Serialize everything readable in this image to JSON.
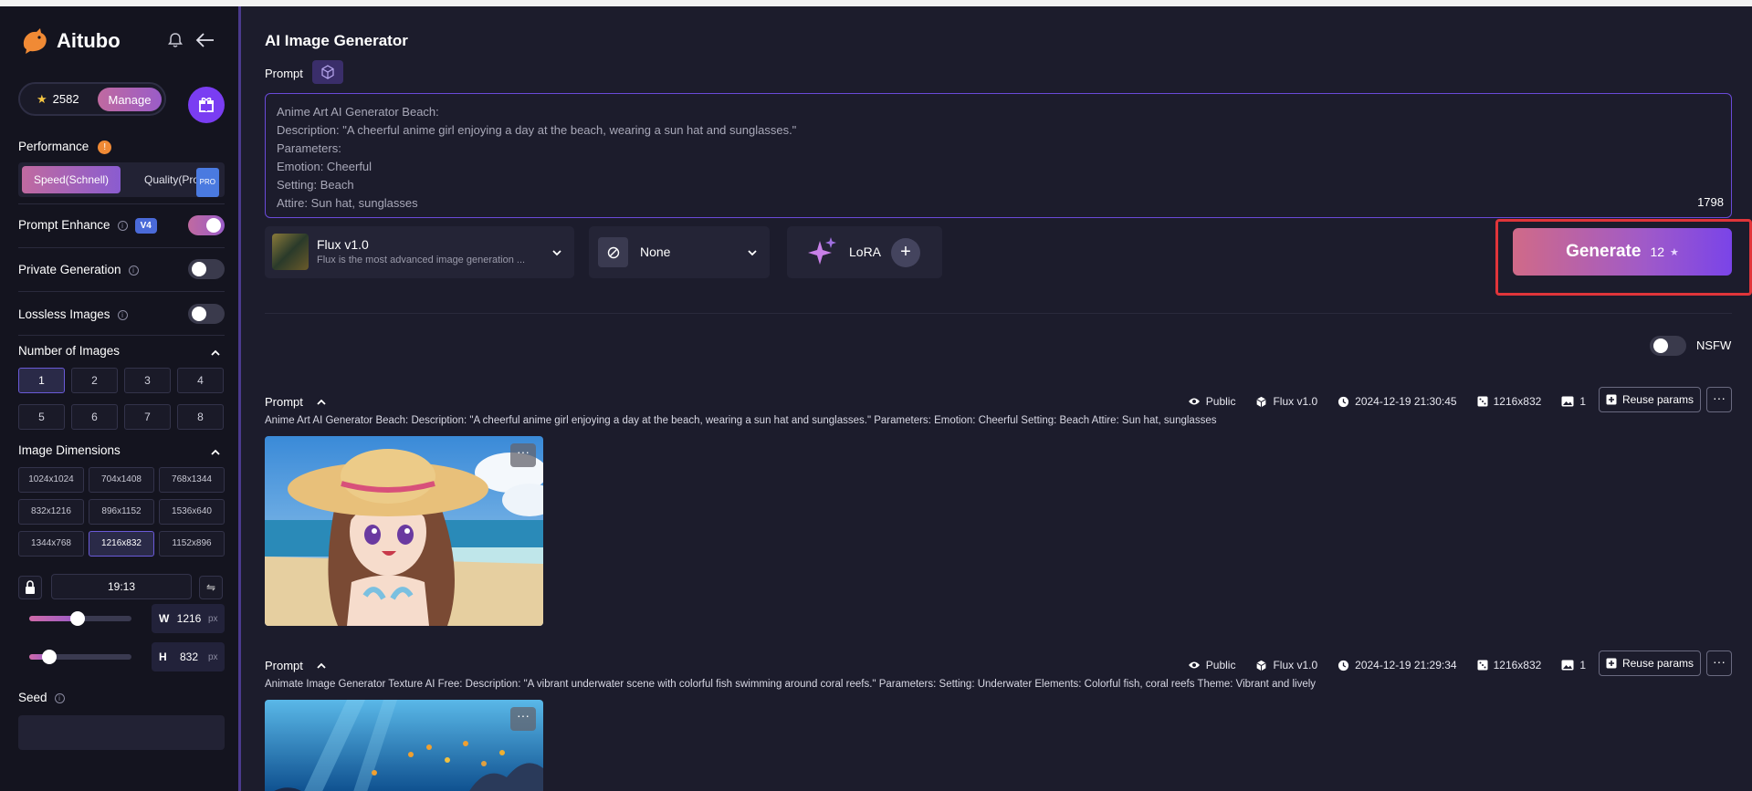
{
  "brand": {
    "name": "Aitubo"
  },
  "credits": {
    "count": "2582",
    "manage_label": "Manage"
  },
  "sidebar": {
    "performance": {
      "label": "Performance",
      "info": "!",
      "speed_label": "Speed(Schnell)",
      "quality_label": "Quality(Pro)",
      "pro_badge": "PRO"
    },
    "prompt_enhance": {
      "label": "Prompt Enhance",
      "badge": "V4",
      "on": true
    },
    "private_generation": {
      "label": "Private Generation",
      "on": false
    },
    "lossless_images": {
      "label": "Lossless Images",
      "on": false
    },
    "number_of_images": {
      "label": "Number of Images",
      "options": [
        "1",
        "2",
        "3",
        "4",
        "5",
        "6",
        "7",
        "8"
      ],
      "selected": "1"
    },
    "image_dimensions": {
      "label": "Image Dimensions",
      "options": [
        "1024x1024",
        "704x1408",
        "768x1344",
        "832x1216",
        "896x1152",
        "1536x640",
        "1344x768",
        "1216x832",
        "1152x896"
      ],
      "selected": "1216x832",
      "ratio": "19:13",
      "swap_icon": "⇋",
      "width_label": "W",
      "width_value": "1216",
      "height_label": "H",
      "height_value": "832",
      "unit": "px",
      "width_fraction": 0.47,
      "height_fraction": 0.2
    },
    "seed": {
      "label": "Seed",
      "value": ""
    }
  },
  "main": {
    "title": "AI Image Generator",
    "prompt_label": "Prompt",
    "prompt_lines": [
      "Anime Art AI Generator Beach:",
      "Description: \"A cheerful anime girl enjoying a day at the beach, wearing a sun hat and sunglasses.\"",
      "Parameters:",
      "Emotion: Cheerful",
      "Setting: Beach",
      "Attire: Sun hat, sunglasses"
    ],
    "char_count": "1798",
    "model": {
      "name": "Flux v1.0",
      "description": "Flux is the most advanced image generation ..."
    },
    "style": {
      "label": "None"
    },
    "lora": {
      "label": "LoRA",
      "add": "+"
    },
    "generate": {
      "label": "Generate",
      "cost": "12",
      "star": "★"
    },
    "nsfw": {
      "label": "NSFW",
      "on": false
    }
  },
  "results": [
    {
      "heading": "Prompt",
      "visibility": "Public",
      "model": "Flux v1.0",
      "timestamp": "2024-12-19 21:30:45",
      "size": "1216x832",
      "count": "1",
      "reuse_label": "Reuse params",
      "more": "···",
      "text": "Anime Art AI Generator Beach: Description: \"A cheerful anime girl enjoying a day at the beach, wearing a sun hat and sunglasses.\" Parameters: Emotion: Cheerful Setting: Beach Attire: Sun hat, sunglasses"
    },
    {
      "heading": "Prompt",
      "visibility": "Public",
      "model": "Flux v1.0",
      "timestamp": "2024-12-19 21:29:34",
      "size": "1216x832",
      "count": "1",
      "reuse_label": "Reuse params",
      "more": "···",
      "text": "Animate Image Generator Texture AI Free: Description: \"A vibrant underwater scene with colorful fish swimming around coral reefs.\" Parameters: Setting: Underwater Elements: Colorful fish, coral reefs Theme: Vibrant and lively"
    }
  ],
  "colors": {
    "accent": "#7a3df2",
    "highlight": "#e0353a",
    "bg": "#1c1c2c",
    "sidebar_bg": "#14141f"
  }
}
